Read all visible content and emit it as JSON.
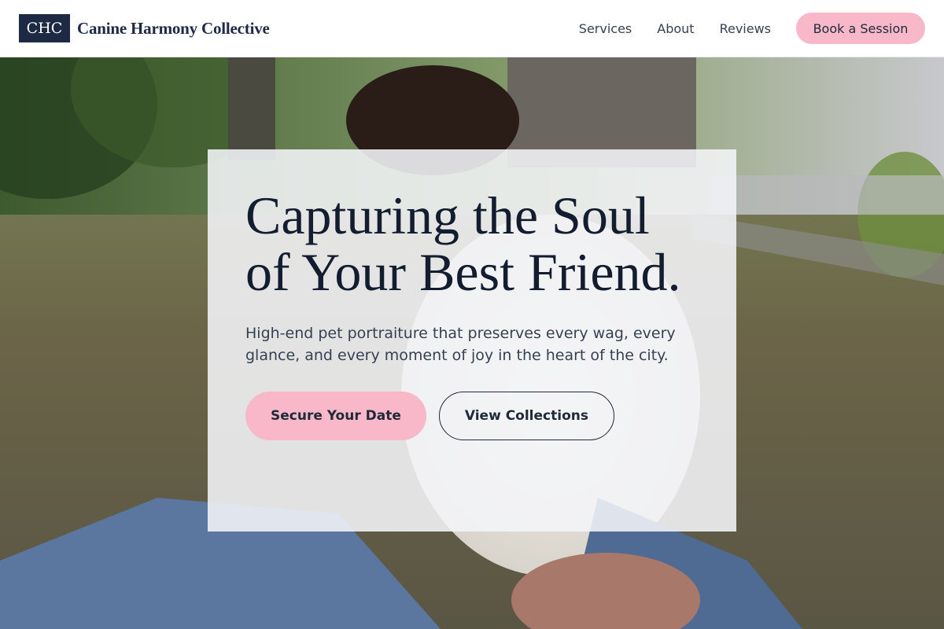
{
  "header": {
    "logo_text": "CHC",
    "brand_name": "Canine Harmony Collective",
    "nav": [
      {
        "label": "Services"
      },
      {
        "label": "About"
      },
      {
        "label": "Reviews"
      }
    ],
    "cta_label": "Book a Session"
  },
  "hero": {
    "headline": "Capturing the Soul of Your Best Friend.",
    "subhead": "High-end pet portraiture that preserves every wag, every glance, and every moment of joy in the heart of the city.",
    "primary_button": "Secure Your Date",
    "secondary_button": "View Collections",
    "background_image": "park-photo-person-with-dog"
  },
  "colors": {
    "navy": "#1e2a44",
    "pink_accent": "#f9b8c9",
    "text_dark": "#141c2f"
  }
}
